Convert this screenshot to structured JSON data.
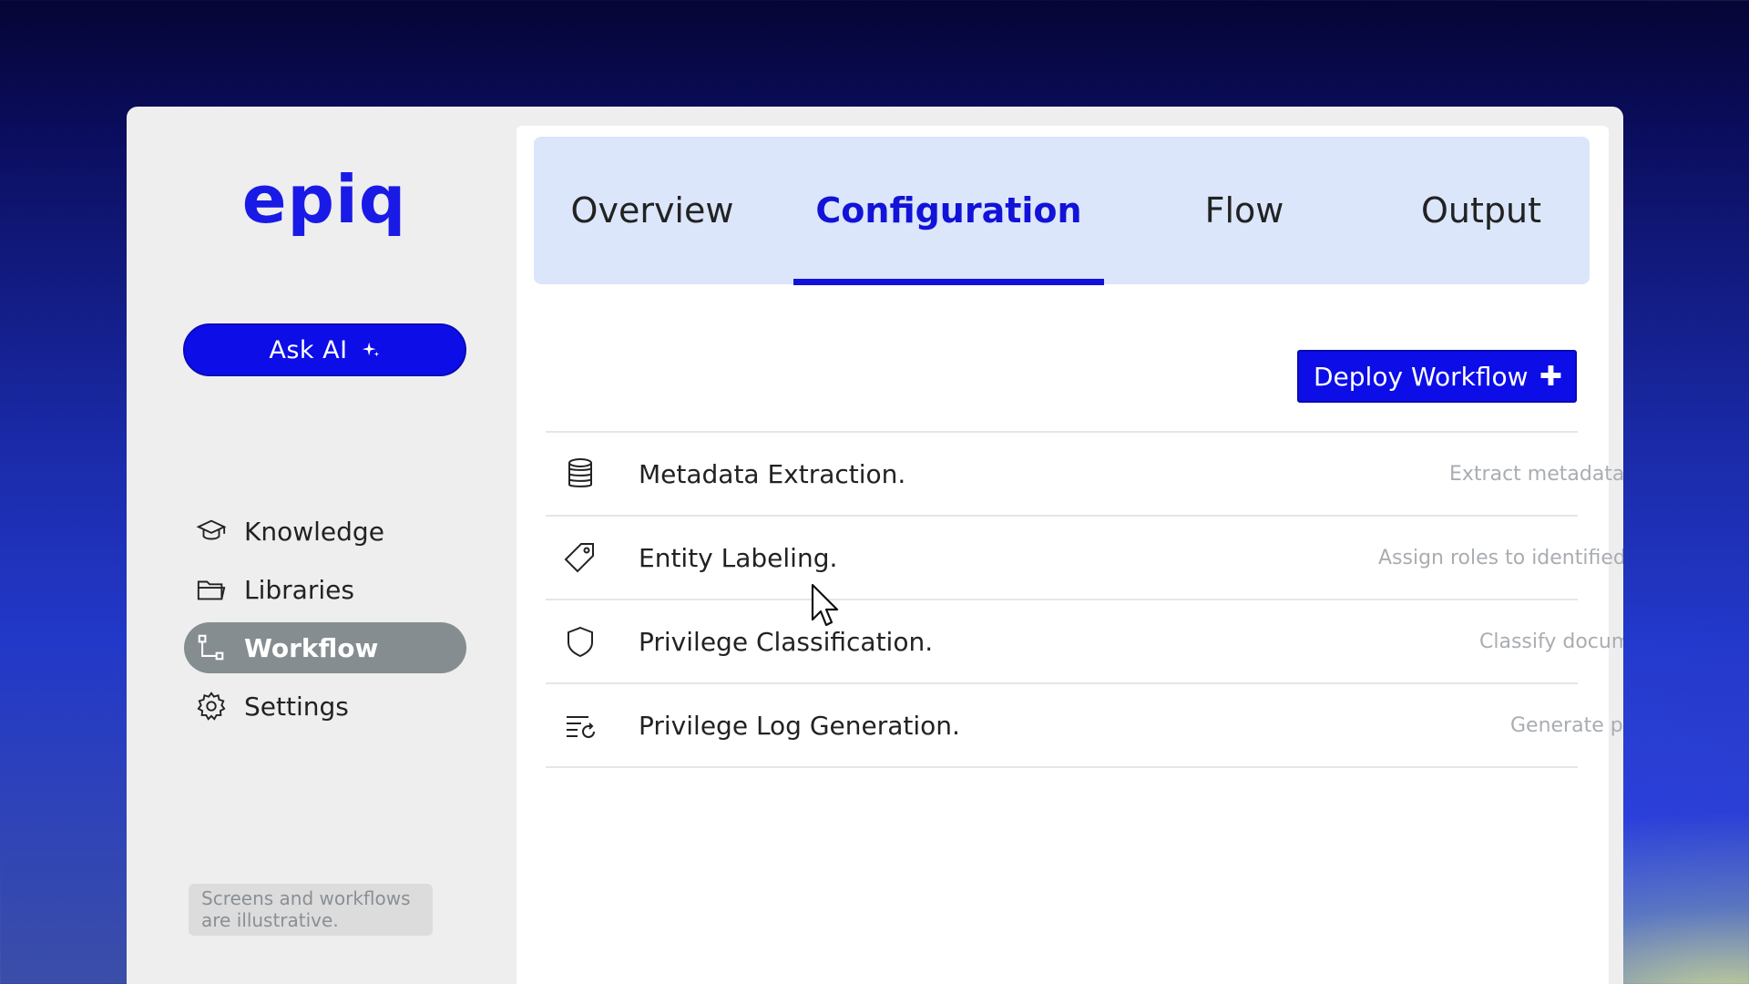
{
  "brand": {
    "logo": "epiq",
    "accent": "#0d0de8"
  },
  "sidebar": {
    "ask_ai": {
      "label": "Ask AI",
      "icon": "sparkle-icon"
    },
    "items": [
      {
        "label": "Knowledge",
        "icon": "graduation-cap-icon",
        "active": false
      },
      {
        "label": "Libraries",
        "icon": "folder-icon",
        "active": false
      },
      {
        "label": "Workflow",
        "icon": "workflow-icon",
        "active": true
      },
      {
        "label": "Settings",
        "icon": "gear-icon",
        "active": false
      }
    ],
    "note": "Screens and workflows are illustrative."
  },
  "tabs": [
    {
      "label": "Overview",
      "active": false
    },
    {
      "label": "Configuration",
      "active": true
    },
    {
      "label": "Flow",
      "active": false
    },
    {
      "label": "Output",
      "active": false
    }
  ],
  "main": {
    "deploy_button": {
      "label": "Deploy Workflow",
      "icon": "plus-icon"
    },
    "steps": [
      {
        "title": "Metadata Extraction.",
        "description": "Extract metadata from source documents",
        "icon": "database-icon"
      },
      {
        "title": "Entity Labeling.",
        "description": "Assign roles to identified entities",
        "icon": "tag-icon"
      },
      {
        "title": "Privilege Classification.",
        "description": "Classify documents by privilege type",
        "icon": "shield-icon"
      },
      {
        "title": "Privilege Log Generation.",
        "description": "Generate privilege log descriptions",
        "icon": "list-refresh-icon"
      }
    ]
  }
}
